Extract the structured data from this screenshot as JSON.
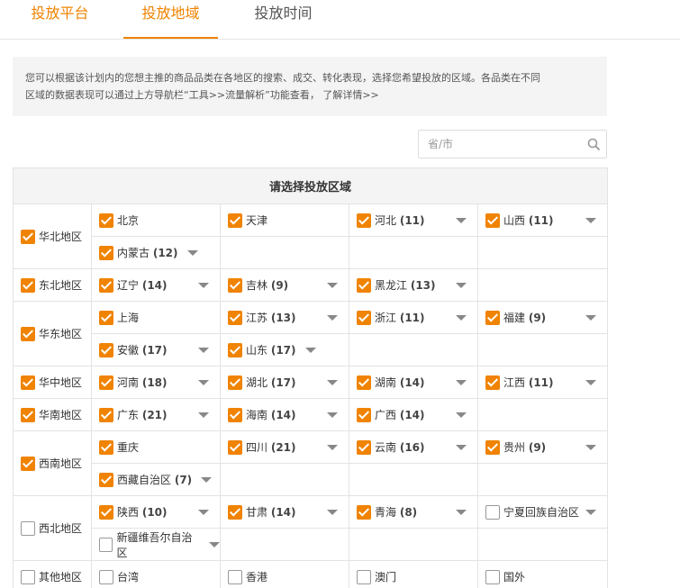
{
  "tabs": [
    "投放平台",
    "投放地域",
    "投放时间"
  ],
  "info": {
    "line1": "您可以根据该计划内的您想主推的商品品类在各地区的搜索、成交、转化表现，选择您希望投放的区域。各品类在不同",
    "line2": "区域的数据表现可以通过上方导航栏“工具>>流量解析”功能查看，",
    "link": "了解详情>>"
  },
  "search": {
    "placeholder": "省/市"
  },
  "table": {
    "header": "请选择投放区域"
  },
  "regions": [
    {
      "name": "华北地区",
      "checked": true,
      "rows": [
        [
          {
            "name": "北京",
            "count": "",
            "checked": true,
            "arrow": false
          },
          {
            "name": "天津",
            "count": "",
            "checked": true,
            "arrow": false
          },
          {
            "name": "河北",
            "count": "(11)",
            "checked": true,
            "arrow": true
          },
          {
            "name": "山西",
            "count": "(11)",
            "checked": true,
            "arrow": true
          }
        ],
        [
          {
            "name": "内蒙古",
            "count": "(12)",
            "checked": true,
            "arrow": true
          }
        ]
      ]
    },
    {
      "name": "东北地区",
      "checked": true,
      "rows": [
        [
          {
            "name": "辽宁",
            "count": "(14)",
            "checked": true,
            "arrow": true
          },
          {
            "name": "吉林",
            "count": "(9)",
            "checked": true,
            "arrow": true
          },
          {
            "name": "黑龙江",
            "count": "(13)",
            "checked": true,
            "arrow": true
          }
        ]
      ]
    },
    {
      "name": "华东地区",
      "checked": true,
      "rows": [
        [
          {
            "name": "上海",
            "count": "",
            "checked": true,
            "arrow": false
          },
          {
            "name": "江苏",
            "count": "(13)",
            "checked": true,
            "arrow": true
          },
          {
            "name": "浙江",
            "count": "(11)",
            "checked": true,
            "arrow": true
          },
          {
            "name": "福建",
            "count": "(9)",
            "checked": true,
            "arrow": true
          }
        ],
        [
          {
            "name": "安徽",
            "count": "(17)",
            "checked": true,
            "arrow": true
          },
          {
            "name": "山东",
            "count": "(17)",
            "checked": true,
            "arrow": true
          }
        ]
      ]
    },
    {
      "name": "华中地区",
      "checked": true,
      "rows": [
        [
          {
            "name": "河南",
            "count": "(18)",
            "checked": true,
            "arrow": true
          },
          {
            "name": "湖北",
            "count": "(17)",
            "checked": true,
            "arrow": true
          },
          {
            "name": "湖南",
            "count": "(14)",
            "checked": true,
            "arrow": true
          },
          {
            "name": "江西",
            "count": "(11)",
            "checked": true,
            "arrow": true
          }
        ]
      ]
    },
    {
      "name": "华南地区",
      "checked": true,
      "rows": [
        [
          {
            "name": "广东",
            "count": "(21)",
            "checked": true,
            "arrow": true
          },
          {
            "name": "海南",
            "count": "(14)",
            "checked": true,
            "arrow": true
          },
          {
            "name": "广西",
            "count": "(14)",
            "checked": true,
            "arrow": true
          }
        ]
      ]
    },
    {
      "name": "西南地区",
      "checked": true,
      "rows": [
        [
          {
            "name": "重庆",
            "count": "",
            "checked": true,
            "arrow": false
          },
          {
            "name": "四川",
            "count": "(21)",
            "checked": true,
            "arrow": true
          },
          {
            "name": "云南",
            "count": "(16)",
            "checked": true,
            "arrow": true
          },
          {
            "name": "贵州",
            "count": "(9)",
            "checked": true,
            "arrow": true
          }
        ],
        [
          {
            "name": "西藏自治区",
            "count": "(7)",
            "checked": true,
            "arrow": true
          }
        ]
      ]
    },
    {
      "name": "西北地区",
      "checked": false,
      "rows": [
        [
          {
            "name": "陕西",
            "count": "(10)",
            "checked": true,
            "arrow": true
          },
          {
            "name": "甘肃",
            "count": "(14)",
            "checked": true,
            "arrow": true
          },
          {
            "name": "青海",
            "count": "(8)",
            "checked": true,
            "arrow": true
          },
          {
            "name": "宁夏回族自治区",
            "count": "",
            "checked": false,
            "arrow": true
          }
        ],
        [
          {
            "name": "新疆维吾尔自治区",
            "count": "",
            "checked": false,
            "arrow": true
          }
        ]
      ]
    },
    {
      "name": "其他地区",
      "checked": false,
      "rows": [
        [
          {
            "name": "台湾",
            "count": "",
            "checked": false,
            "arrow": false
          },
          {
            "name": "香港",
            "count": "",
            "checked": false,
            "arrow": false
          },
          {
            "name": "澳门",
            "count": "",
            "checked": false,
            "arrow": false
          },
          {
            "name": "国外",
            "count": "",
            "checked": false,
            "arrow": false
          }
        ]
      ]
    }
  ],
  "colors": {
    "accent": "#f08300",
    "border": "#e3e3e3",
    "info_bg": "#f4f4f4"
  }
}
